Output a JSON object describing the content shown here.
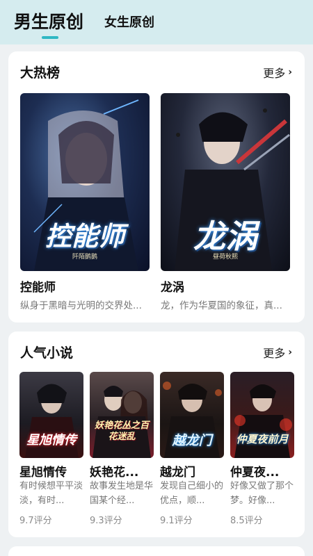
{
  "tabs": {
    "active": "男生原创",
    "other": "女生原创"
  },
  "section_hot": {
    "title": "大热榜",
    "more": "更多",
    "books": [
      {
        "cover_title": "控能师",
        "cover_author": "阡陌鹅鹅",
        "name": "控能师",
        "desc": "纵身于黑暗与光明的交界处..."
      },
      {
        "cover_title": "龙涡",
        "cover_author": "昼荷秋熙",
        "name": "龙涡",
        "desc": "龙，作为华夏国的象征，真..."
      }
    ]
  },
  "section_popular": {
    "title": "人气小说",
    "more": "更多",
    "books": [
      {
        "cover_title": "星旭情传",
        "name": "星旭情传",
        "desc": "有时候想平平淡淡，有时...",
        "score": "9.7评分"
      },
      {
        "cover_title": "妖艳花丛之百花迷乱",
        "name": "妖艳花...",
        "desc": "故事发生地是华国某个经...",
        "score": "9.3评分"
      },
      {
        "cover_title": "越龙门",
        "name": "越龙门",
        "desc": "发现自己细小的优点，顺...",
        "score": "9.1评分"
      },
      {
        "cover_title": "仲夏夜前月",
        "name": "仲夏夜...",
        "desc": "好像又做了那个梦。好像...",
        "score": "8.5评分"
      }
    ]
  },
  "colors": {
    "accent": "#2fb8c4",
    "header_bg": "#d5ecef",
    "page_bg": "#eef1f3"
  }
}
